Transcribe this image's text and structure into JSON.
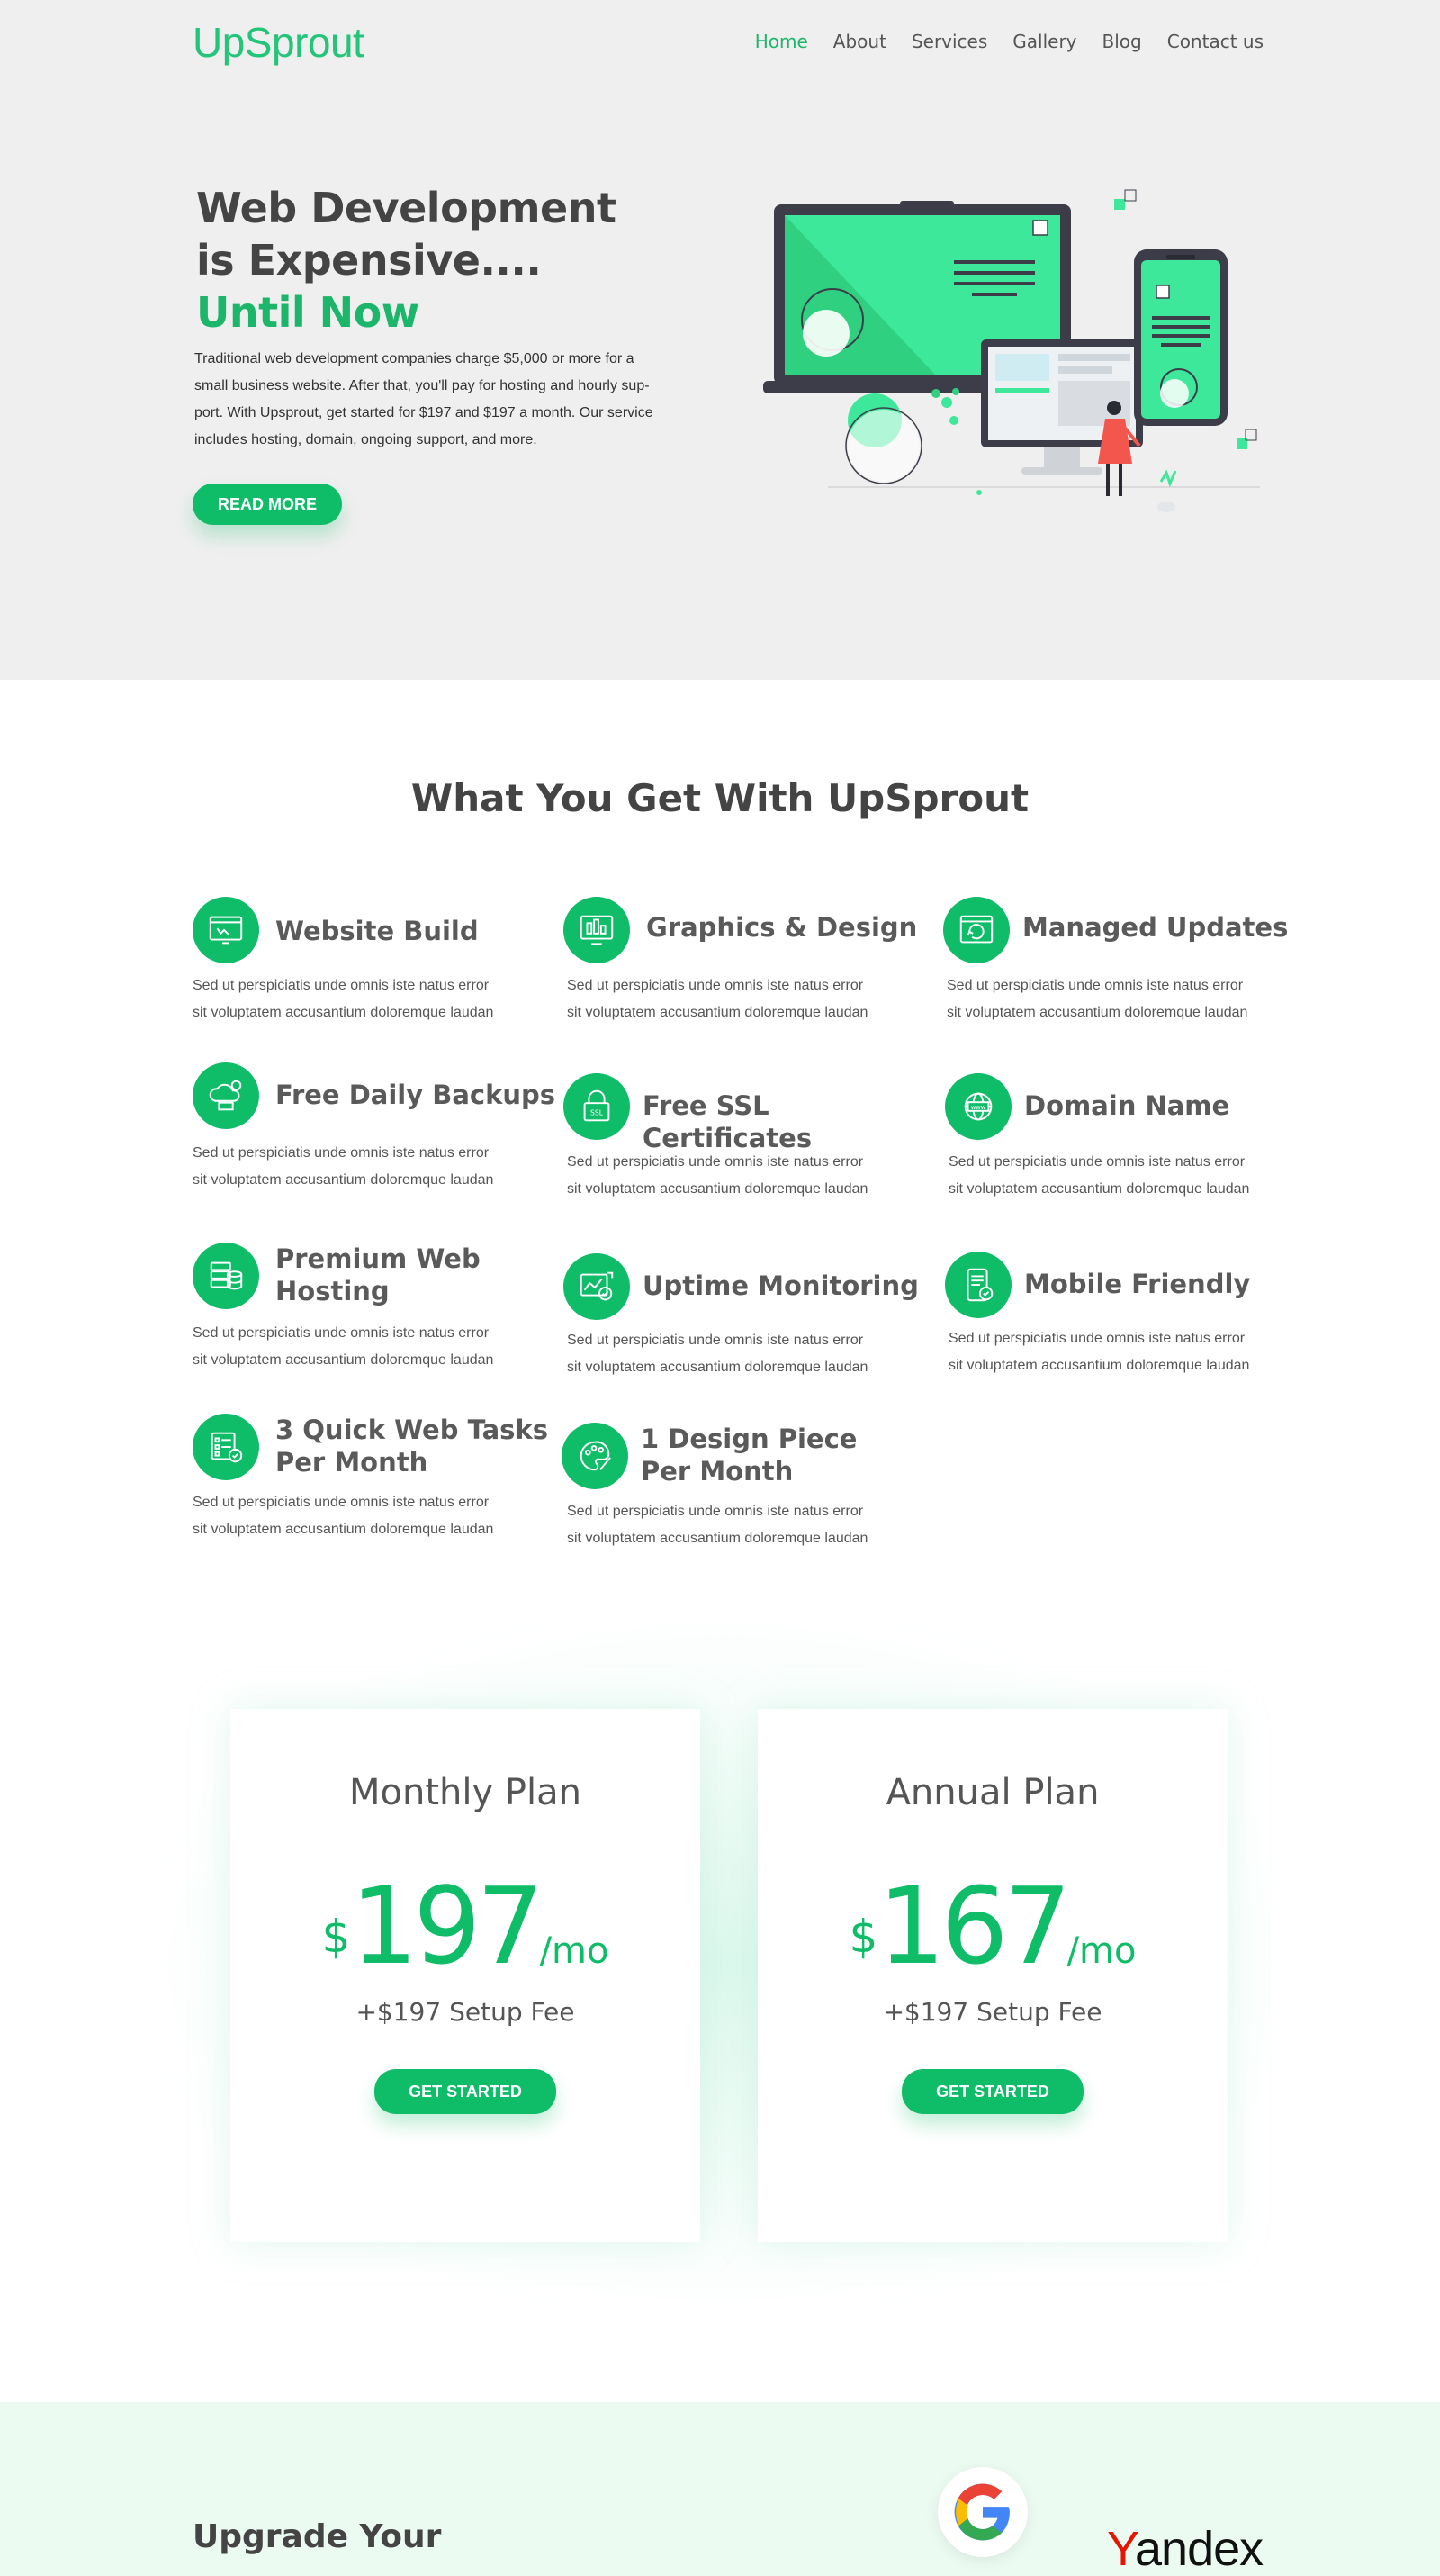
{
  "brand": {
    "logo_text": "UpSprout",
    "accent_color": "#0fbc68",
    "text_color": "#444444"
  },
  "nav": {
    "items": [
      {
        "label": "Home",
        "active": true
      },
      {
        "label": "About",
        "active": false
      },
      {
        "label": "Services",
        "active": false
      },
      {
        "label": "Gallery",
        "active": false
      },
      {
        "label": "Blog",
        "active": false
      },
      {
        "label": "Contact us",
        "active": false
      }
    ]
  },
  "hero": {
    "title_line1": "Web Development",
    "title_line2": "is Expensive....",
    "title_line3": "Until Now",
    "text_line1": "Traditional web development companies charge $5,000 or more for a",
    "text_line2": "small business website. After that, you'll pay for hosting and hourly sup-",
    "text_line3": "port. With Upsprout, get started for $197 and $197 a month. Our service",
    "text_line4": "includes hosting, domain, ongoing support, and more.",
    "button_label": "READ MORE",
    "illustration_icon": "devices-illustration"
  },
  "features": {
    "title": "What You Get With UpSprout",
    "body_line1": "Sed ut perspiciatis unde omnis iste natus error",
    "body_line2": "sit voluptatem accusantium doloremque laudan",
    "items": [
      {
        "title_line1": "Website Build",
        "title_line2": "",
        "icon": "website-build-icon"
      },
      {
        "title_line1": "Graphics & Design",
        "title_line2": "",
        "icon": "graphics-design-icon"
      },
      {
        "title_line1": "Managed Updates",
        "title_line2": "",
        "icon": "managed-updates-icon"
      },
      {
        "title_line1": "Free Daily Backups",
        "title_line2": "",
        "icon": "cloud-backup-icon"
      },
      {
        "title_line1": "Free SSL Certificates",
        "title_line2": "",
        "icon": "ssl-lock-icon"
      },
      {
        "title_line1": "Domain Name",
        "title_line2": "",
        "icon": "globe-www-icon"
      },
      {
        "title_line1": "Premium Web",
        "title_line2": "Hosting",
        "icon": "server-database-icon"
      },
      {
        "title_line1": "Uptime Monitoring",
        "title_line2": "",
        "icon": "monitoring-chart-icon"
      },
      {
        "title_line1": "Mobile Friendly",
        "title_line2": "",
        "icon": "mobile-check-icon"
      },
      {
        "title_line1": "3 Quick Web Tasks",
        "title_line2": "Per Month",
        "icon": "task-list-icon"
      },
      {
        "title_line1": "1 Design Piece",
        "title_line2": "Per Month",
        "icon": "palette-brush-icon"
      }
    ]
  },
  "pricing": {
    "plans": [
      {
        "name": "Monthly Plan",
        "currency": "$",
        "price": "197",
        "period": "/mo",
        "fee": "+$197 Setup Fee",
        "button_label": "GET STARTED"
      },
      {
        "name": "Annual Plan",
        "currency": "$",
        "price": "167",
        "period": "/mo",
        "fee": "+$197 Setup Fee",
        "button_label": "GET STARTED"
      }
    ]
  },
  "bottom": {
    "heading": "Upgrade Your",
    "logos": [
      {
        "name": "google-logo-icon",
        "text": "G"
      },
      {
        "name": "yandex-logo",
        "text": "Yandex"
      }
    ]
  }
}
